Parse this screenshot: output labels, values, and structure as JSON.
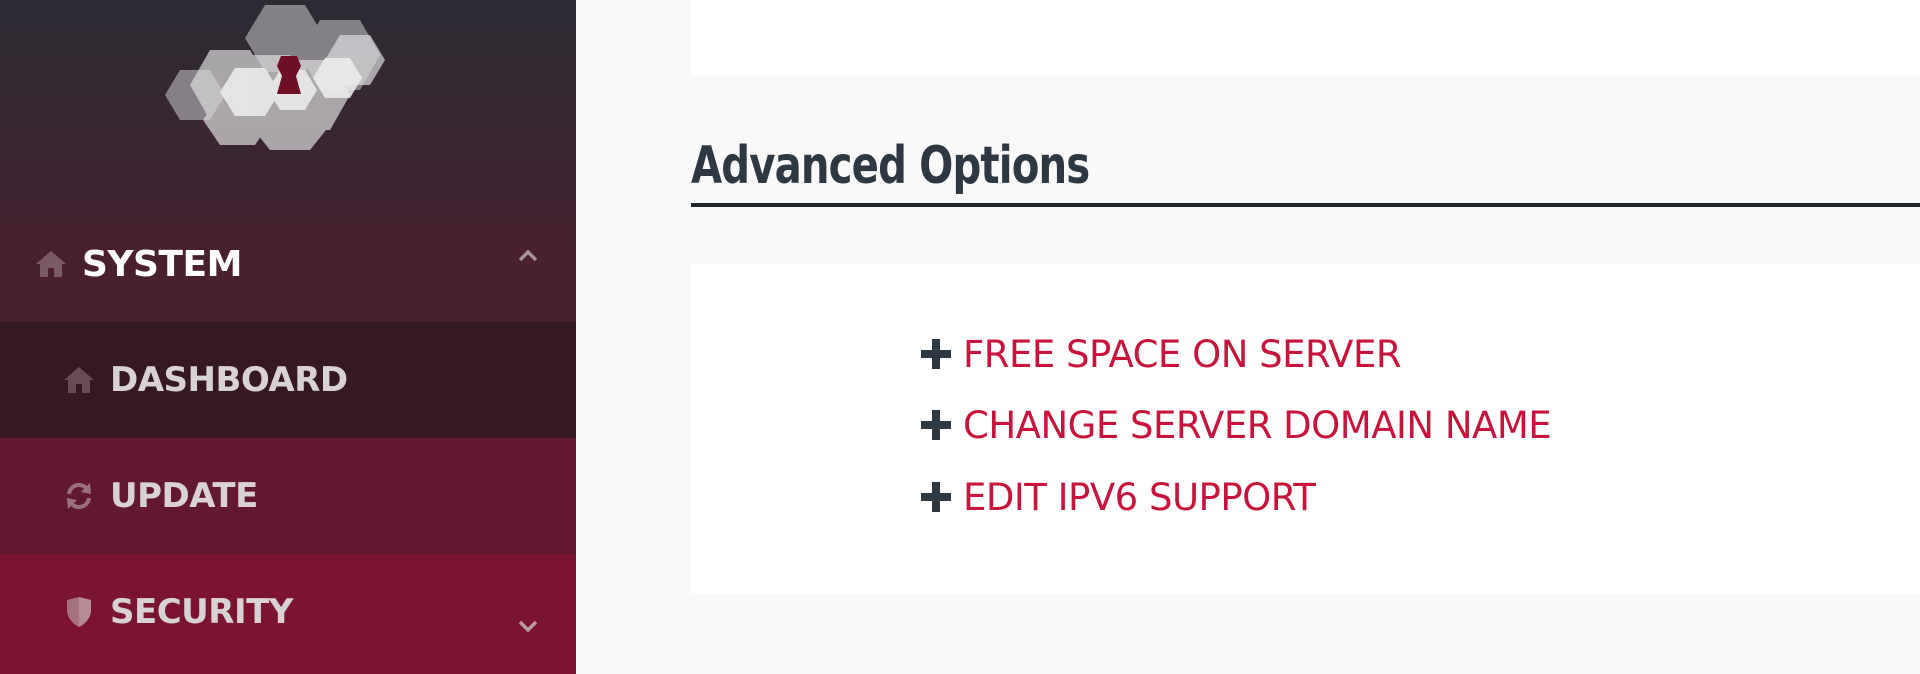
{
  "sidebar": {
    "items": [
      {
        "label": "SYSTEM",
        "icon": "home-icon",
        "chevron": "chevron-up-icon"
      },
      {
        "label": "DASHBOARD",
        "icon": "home-icon"
      },
      {
        "label": "UPDATE",
        "icon": "refresh-icon"
      },
      {
        "label": "SECURITY",
        "icon": "shield-icon",
        "chevron": "chevron-down-icon"
      }
    ]
  },
  "main": {
    "title": "Advanced Options",
    "options": [
      {
        "label": "FREE SPACE ON SERVER",
        "icon": "plus-icon"
      },
      {
        "label": "CHANGE SERVER DOMAIN NAME",
        "icon": "plus-icon"
      },
      {
        "label": "EDIT IPV6 SUPPORT",
        "icon": "plus-icon"
      }
    ]
  },
  "colors": {
    "accent": "#c8143c",
    "title": "#2e3842",
    "logo_keyhole": "#6e0f26"
  }
}
